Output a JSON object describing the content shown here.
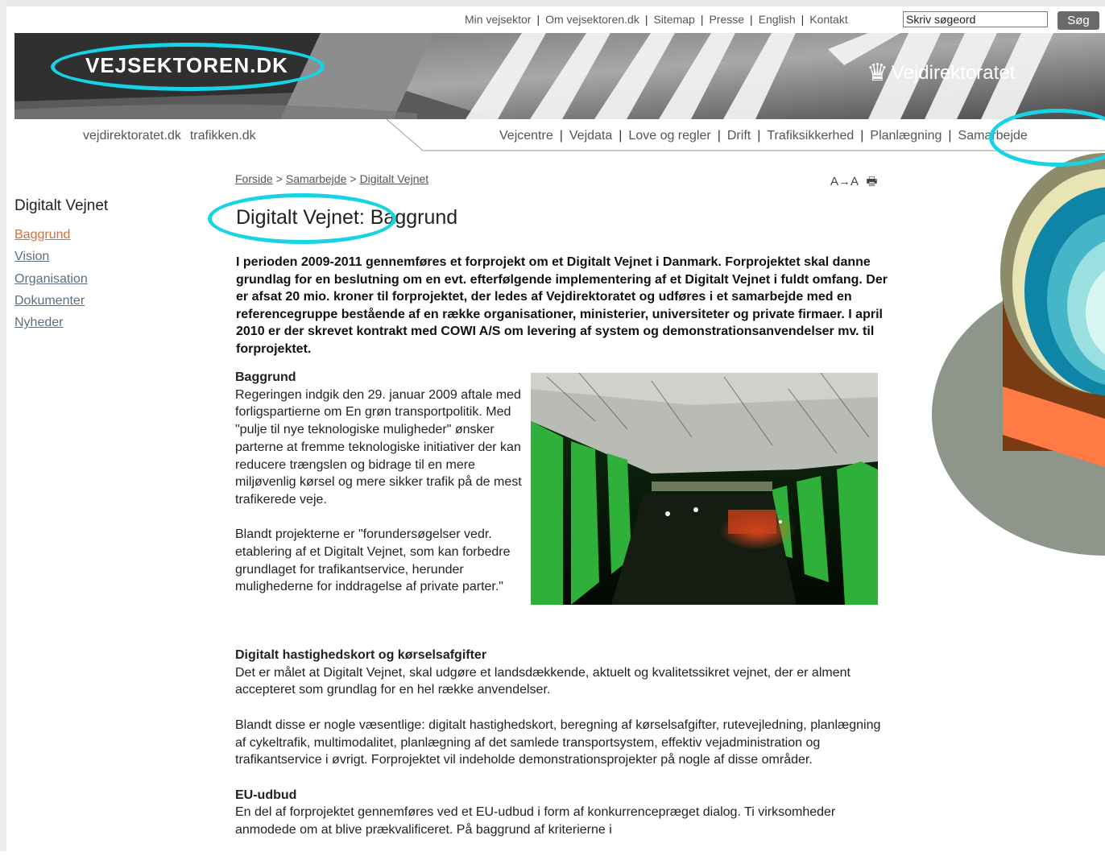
{
  "toplinks": [
    "Min vejsektor",
    "Om vejsektoren.dk",
    "Sitemap",
    "Presse",
    "English",
    "Kontakt"
  ],
  "search": {
    "value": "Skriv søgeord",
    "button": "Søg"
  },
  "banner": {
    "site_logo": "VEJSEKTOREN.DK",
    "agency_logo": "Vejdirektoratet"
  },
  "extlinks": [
    "vejdirektoratet.dk",
    "trafikken.dk"
  ],
  "mainnav": [
    "Vejcentre",
    "Vejdata",
    "Love og regler",
    "Drift",
    "Trafiksikkerhed",
    "Planlægning",
    "Samarbejde"
  ],
  "breadcrumb": {
    "home": "Forside",
    "sep1": ">",
    "section": "Samarbejde",
    "sep2": ">",
    "current": "Digitalt Vejnet"
  },
  "tools": {
    "textsize": "A→A",
    "print_icon": "print-icon"
  },
  "sidebar": {
    "title": "Digitalt Vejnet",
    "items": [
      {
        "label": "Baggrund",
        "active": true
      },
      {
        "label": "Vision",
        "active": false
      },
      {
        "label": "Organisation",
        "active": false
      },
      {
        "label": "Dokumenter",
        "active": false
      },
      {
        "label": "Nyheder",
        "active": false
      }
    ]
  },
  "article": {
    "title": "Digitalt Vejnet: Baggrund",
    "intro": "I perioden 2009-2011 gennemføres et forprojekt om et Digitalt Vejnet i Danmark. Forprojektet skal danne grundlag for en beslutning om en evt. efterfølgende implementering af et Digitalt Vejnet i fuldt omfang. Der er afsat 20 mio. kroner til forprojektet, der ledes af Vejdirektoratet og udføres i et samarbejde med en referencegruppe bestående af en række organisationer, ministerier, universiteter og private firmaer.  I april 2010 er der skrevet kontrakt med COWI A/S om levering af system og demonstrationsanvendelser mv. til forprojektet.",
    "sec1_head": "Baggrund",
    "sec1_p1": "Regeringen indgik den 29. januar 2009 aftale med forligspartierne om En grøn transportpolitik. Med \"pulje til nye teknologiske muligheder\" ønsker parterne at fremme teknologiske initiativer der kan reducere trængslen og bidrage til en mere miljøvenlig kørsel og mere sikker trafik på de mest trafikerede veje.",
    "sec1_p2": "Blandt projekterne er \"forundersøgelser vedr. etablering af et Digitalt Vejnet, som kan forbedre grundlaget for trafikantservice, herunder mulighederne for inddragelse af private parter.\"",
    "sec2_head": "Digitalt hastighedskort og kørselsafgifter",
    "sec2_p1": "Det er målet at Digitalt Vejnet, skal udgøre et landsdækkende, aktuelt og kvalitetssikret vejnet, der er alment accepteret som grundlag for en hel række anvendelser.",
    "sec2_p2": "Blandt disse er nogle væsentlige: digitalt hastighedskort, beregning af kørselsafgifter, rutevejledning, planlægning af cykeltrafik, multimodalitet, planlægning af det samlede transportsystem, effektiv vejadministration og trafikantservice i øvrigt. Forprojektet vil indeholde demonstrationsprojekter på nogle af disse områder.",
    "sec3_head": "EU-udbud",
    "sec3_p1": "En del af forprojektet gennemføres ved et EU-udbud i form af konkurrencepræget dialog. Ti virksomheder anmodede om at blive prækvalificeret. På baggrund af kriterierne i"
  },
  "colors": {
    "annotation": "#17d3e6",
    "active_link": "#d0703a",
    "link": "#5d6f80"
  }
}
